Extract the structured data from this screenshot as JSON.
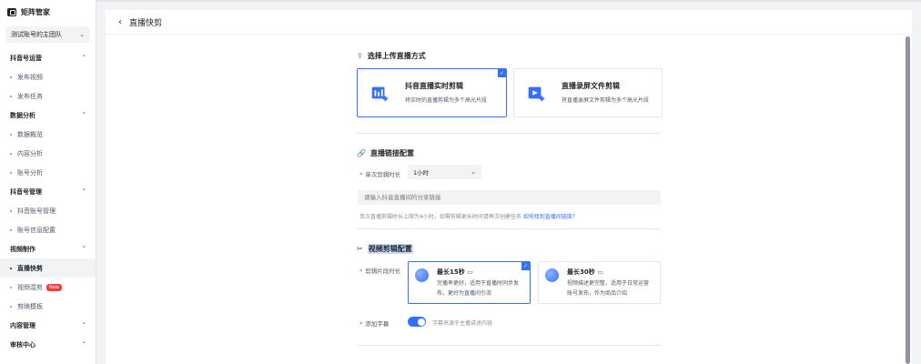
{
  "brand": {
    "title": "矩阵管家",
    "logo_icon": "matrix-logo-icon"
  },
  "team_selector": {
    "value": "测试账号的主团队"
  },
  "nav": {
    "douyin_ops": {
      "label": "抖音号运营",
      "items": [
        "发布视频",
        "发布任务"
      ]
    },
    "data_analysis": {
      "label": "数据分析",
      "items": [
        "数据概览",
        "内容分析",
        "账号分析"
      ]
    },
    "account_mgmt": {
      "label": "抖音号管理",
      "items": [
        "抖音账号管理",
        "账号信息配置"
      ]
    },
    "video_production": {
      "label": "视频制作",
      "items": [
        "直播快剪",
        "视频混剪",
        "剪映模板"
      ],
      "new_badge": "New"
    },
    "content_mgmt": {
      "label": "内容管理"
    },
    "review_center": {
      "label": "审核中心"
    }
  },
  "page": {
    "title": "直播快剪"
  },
  "upload_section": {
    "title": "选择上传直播方式",
    "cards": [
      {
        "title": "抖音直播实时剪辑",
        "desc": "将实时的直播剪辑为多个高光片段",
        "selected": true
      },
      {
        "title": "直播录屏文件剪辑",
        "desc": "将直播录屏文件剪辑为多个高光片段",
        "selected": false
      }
    ]
  },
  "link_section": {
    "title": "直播链接配置",
    "duration_label": "单次剪辑时长",
    "duration_value": "1小时",
    "link_placeholder": "请输入抖音直播间的分享链接",
    "hint": "单次直播剪辑时长上限为4小时，如需剪辑更长时间请再次创建任务",
    "hint_link": "如何找到直播间链接?"
  },
  "video_section": {
    "title": "视频剪辑配置",
    "clip_label": "剪辑片段时长",
    "options": [
      {
        "title": "最长15秒",
        "desc_1": "完播率更好，适用于直播时同步发",
        "desc_2": "布，更好为直播间引流",
        "selected": true
      },
      {
        "title": "最长30秒",
        "desc_1": "视频描述更完整，适用于日常运营",
        "desc_2": "账号发布，作为商品介绍",
        "selected": false
      }
    ],
    "subtitle_label": "添加字幕",
    "subtitle_desc": "字幕来源于主播讲述内容",
    "subtitle_enabled": true
  },
  "colors": {
    "accent": "#3370ff",
    "required": "#f53f3f"
  }
}
